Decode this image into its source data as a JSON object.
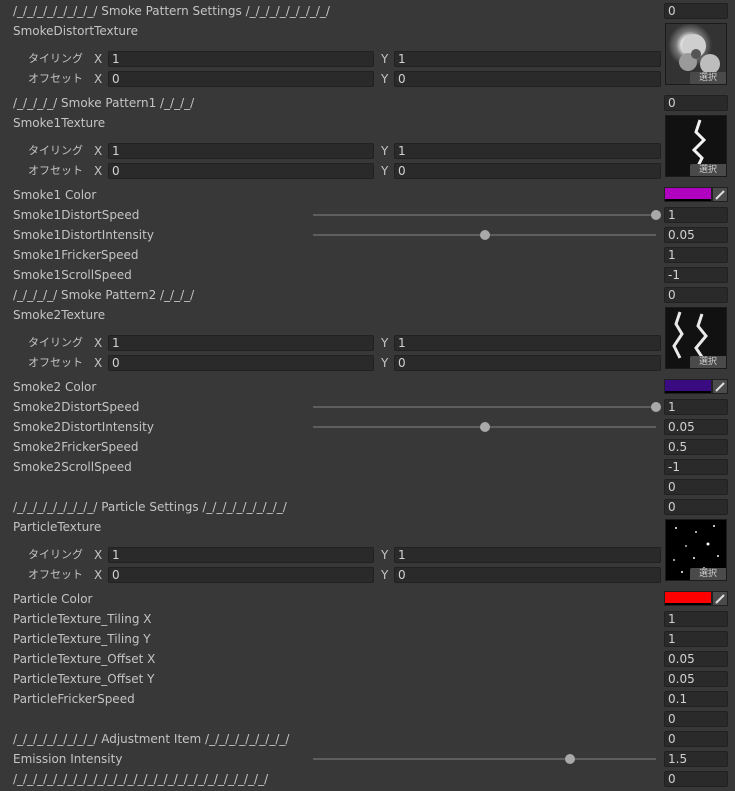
{
  "smoke_pattern_settings": {
    "header": "/_/_/_/_/_/_/_/_/  Smoke Pattern Settings /_/_/_/_/_/_/_/_/",
    "value": "0"
  },
  "smoke_distort_texture": {
    "label": "SmokeDistortTexture",
    "tiling_label": "タイリング",
    "offset_label": "オフセット",
    "tiling_x": "1",
    "tiling_y": "1",
    "offset_x": "0",
    "offset_y": "0",
    "select_label": "選択"
  },
  "smoke_pattern1": {
    "header": "/_/_/_/_/ Smoke Pattern1 /_/_/_/",
    "value": "0"
  },
  "smoke1_texture": {
    "label": "Smoke1Texture",
    "tiling_label": "タイリング",
    "offset_label": "オフセット",
    "tiling_x": "1",
    "tiling_y": "1",
    "offset_x": "0",
    "offset_y": "0",
    "select_label": "選択"
  },
  "smoke1_color": {
    "label": "Smoke1 Color",
    "color": "#b000c0"
  },
  "smoke1_distort_speed": {
    "label": "Smoke1DistortSpeed",
    "value": "1",
    "slider_fraction": 1.0
  },
  "smoke1_distort_intensity": {
    "label": "Smoke1DistortIntensity",
    "value": "0.05",
    "slider_fraction": 0.5
  },
  "smoke1_fricker_speed": {
    "label": "Smoke1FrickerSpeed",
    "value": "1"
  },
  "smoke1_scroll_speed": {
    "label": "Smoke1ScrollSpeed",
    "value": "-1"
  },
  "smoke_pattern2": {
    "header": "/_/_/_/_/ Smoke Pattern2 /_/_/_/",
    "value": "0"
  },
  "smoke2_texture": {
    "label": "Smoke2Texture",
    "tiling_label": "タイリング",
    "offset_label": "オフセット",
    "tiling_x": "1",
    "tiling_y": "1",
    "offset_x": "0",
    "offset_y": "0",
    "select_label": "選択"
  },
  "smoke2_color": {
    "label": "Smoke2 Color",
    "color": "#3a0a80"
  },
  "smoke2_distort_speed": {
    "label": "Smoke2DistortSpeed",
    "value": "1",
    "slider_fraction": 1.0
  },
  "smoke2_distort_intensity": {
    "label": "Smoke2DistortIntensity",
    "value": "0.05",
    "slider_fraction": 0.5
  },
  "smoke2_fricker_speed": {
    "label": "Smoke2FrickerSpeed",
    "value": "0.5"
  },
  "smoke2_scroll_speed": {
    "label": "Smoke2ScrollSpeed",
    "value": "-1"
  },
  "spacer_value_1": "0",
  "particle_settings": {
    "header": "/_/_/_/_/_/_/_/_/  Particle Settings /_/_/_/_/_/_/_/_/",
    "value": "0"
  },
  "particle_texture": {
    "label": "ParticleTexture",
    "tiling_label": "タイリング",
    "offset_label": "オフセット",
    "tiling_x": "1",
    "tiling_y": "1",
    "offset_x": "0",
    "offset_y": "0",
    "select_label": "選択"
  },
  "particle_color": {
    "label": "Particle Color",
    "color": "#ff0000"
  },
  "particle_tiling_x": {
    "label": "ParticleTexture_Tiling X",
    "value": "1"
  },
  "particle_tiling_y": {
    "label": "ParticleTexture_Tiling Y",
    "value": "1"
  },
  "particle_offset_x": {
    "label": "ParticleTexture_Offset X",
    "value": "0.05"
  },
  "particle_offset_y": {
    "label": "ParticleTexture_Offset Y",
    "value": "0.05"
  },
  "particle_fricker_speed": {
    "label": "ParticleFrickerSpeed",
    "value": "0.1"
  },
  "spacer_value_2": "0",
  "adjustment_item": {
    "header": "/_/_/_/_/_/_/_/_/  Adjustment Item /_/_/_/_/_/_/_/_/",
    "value": "0"
  },
  "emission_intensity": {
    "label": "Emission Intensity",
    "value": "1.5",
    "slider_fraction": 0.75
  },
  "footer": {
    "header": "/_/_/_/_/_/_/_/_/_/_/_/_/_/_/_/_/_/_/_/_/_/_/_/_/_/",
    "value": "0"
  },
  "axis": {
    "x": "X",
    "y": "Y"
  }
}
